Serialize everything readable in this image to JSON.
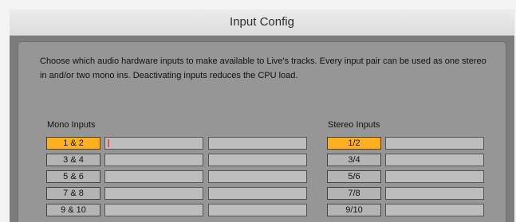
{
  "window": {
    "title": "Input Config"
  },
  "description": "Choose which audio hardware inputs to make available to Live's tracks. Every input pair can be used as one stereo in and/or two mono ins.  Deactivating inputs reduces the CPU load.",
  "mono_inputs": {
    "heading": "Mono Inputs",
    "pairs": [
      {
        "label": "1 & 2",
        "active": true
      },
      {
        "label": "3 & 4",
        "active": false
      },
      {
        "label": "5 & 6",
        "active": false
      },
      {
        "label": "7 & 8",
        "active": false
      },
      {
        "label": "9 & 10",
        "active": false
      }
    ]
  },
  "stereo_inputs": {
    "heading": "Stereo Inputs",
    "pairs": [
      {
        "label": "1/2",
        "active": true
      },
      {
        "label": "3/4",
        "active": false
      },
      {
        "label": "5/6",
        "active": false
      },
      {
        "label": "7/8",
        "active": false
      },
      {
        "label": "9/10",
        "active": false
      }
    ]
  },
  "colors": {
    "active": "#ffb020",
    "inactive": "#b4b4b4",
    "panel": "#969696"
  }
}
